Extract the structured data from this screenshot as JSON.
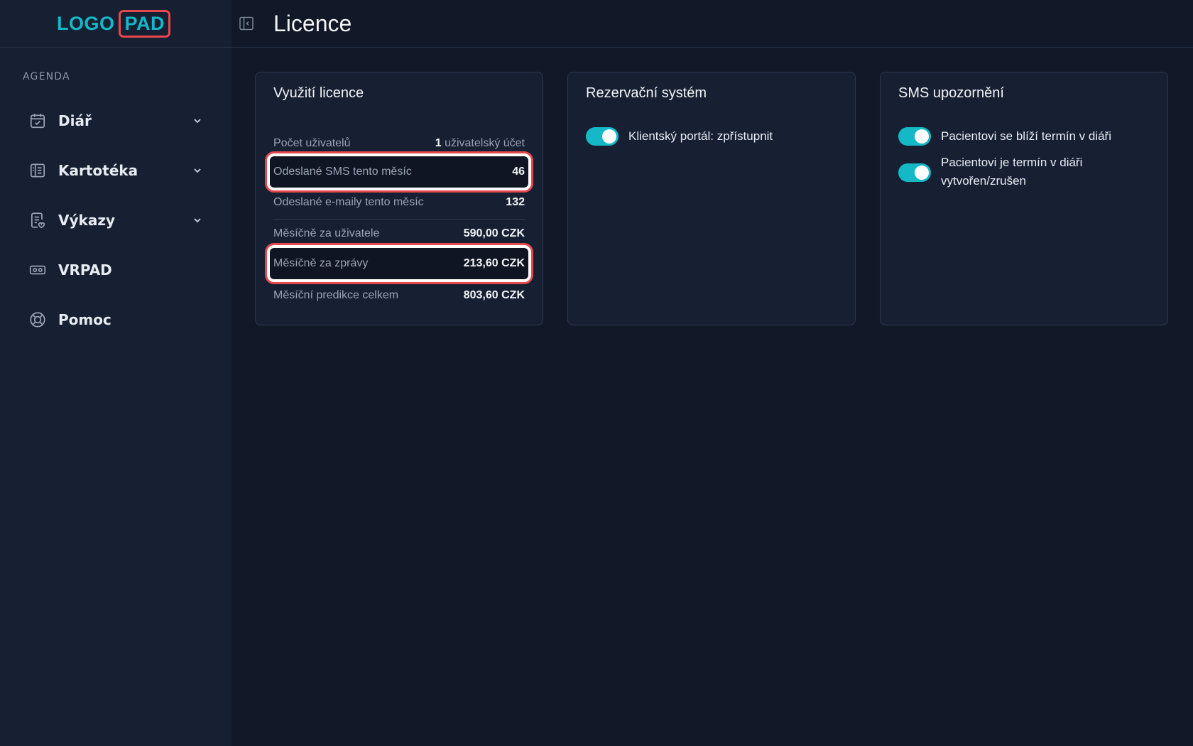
{
  "logo": {
    "part1": "LOGO",
    "part2": "PAD"
  },
  "sidebar": {
    "section_label": "AGENDA",
    "items": [
      {
        "label": "Diář",
        "icon": "calendar-check-icon",
        "has_chevron": true
      },
      {
        "label": "Kartotéka",
        "icon": "card-index-icon",
        "has_chevron": true
      },
      {
        "label": "Výkazy",
        "icon": "report-icon",
        "has_chevron": true
      },
      {
        "label": "VRPAD",
        "icon": "vr-headset-icon",
        "has_chevron": false
      },
      {
        "label": "Pomoc",
        "icon": "lifebuoy-icon",
        "has_chevron": false
      }
    ]
  },
  "header": {
    "title": "Licence"
  },
  "license_card": {
    "title": "Využití licence",
    "rows": [
      {
        "label": "Počet uživatelů",
        "value_num": "1",
        "value_text": "uživatelský účet"
      },
      {
        "label": "Odeslané SMS tento měsíc",
        "value": "46",
        "highlighted": true
      },
      {
        "label": "Odeslané e-maily tento měsíc",
        "value": "132"
      },
      {
        "label": "Měsíčně za uživatele",
        "value": "590,00 CZK"
      },
      {
        "label": "Měsíčně za zprávy",
        "value": "213,60 CZK",
        "highlighted": true
      },
      {
        "label": "Měsíční predikce celkem",
        "value": "803,60 CZK"
      }
    ]
  },
  "booking_card": {
    "title": "Rezervační systém",
    "toggles": [
      {
        "label": "Klientský portál: zpřístupnit",
        "on": true
      }
    ]
  },
  "sms_card": {
    "title": "SMS upozornění",
    "toggles": [
      {
        "label": "Pacientovi se blíží termín v diáři",
        "on": true
      },
      {
        "label_line1": "Pacientovi je termín v diáři",
        "label_line2": "vytvořen/zrušen",
        "on": true
      }
    ]
  },
  "colors": {
    "accent": "#14b8c7",
    "highlight": "#e5484d",
    "background": "#111827",
    "panel": "#172033"
  }
}
